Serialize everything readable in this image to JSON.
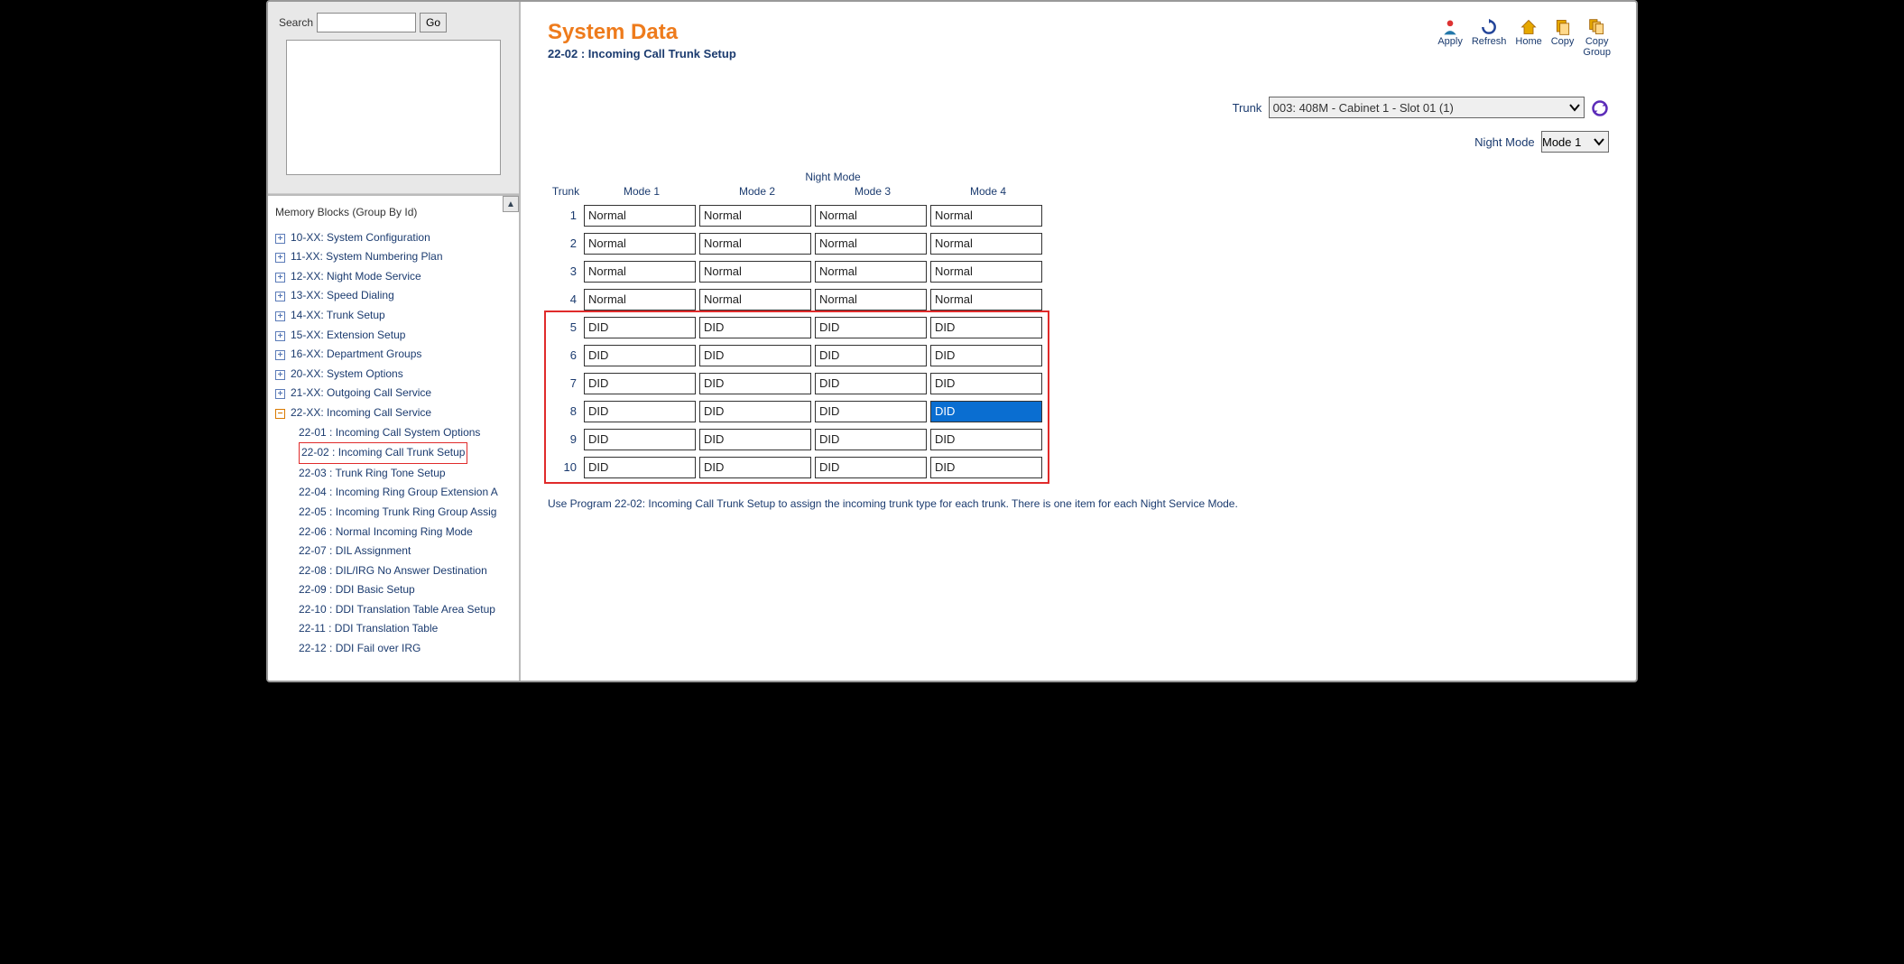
{
  "search": {
    "label": "Search",
    "go": "Go",
    "value": ""
  },
  "tree": {
    "heading": "Memory Blocks (Group By Id)",
    "items": [
      {
        "label": "10-XX: System Configuration",
        "expanded": false
      },
      {
        "label": "11-XX: System Numbering Plan",
        "expanded": false
      },
      {
        "label": "12-XX: Night Mode Service",
        "expanded": false
      },
      {
        "label": "13-XX: Speed Dialing",
        "expanded": false
      },
      {
        "label": "14-XX: Trunk Setup",
        "expanded": false
      },
      {
        "label": "15-XX: Extension Setup",
        "expanded": false
      },
      {
        "label": "16-XX: Department Groups",
        "expanded": false
      },
      {
        "label": "20-XX: System Options",
        "expanded": false
      },
      {
        "label": "21-XX: Outgoing Call Service",
        "expanded": false
      },
      {
        "label": "22-XX: Incoming Call Service",
        "expanded": true,
        "children": [
          {
            "label": "22-01 : Incoming Call System Options",
            "highlighted": false
          },
          {
            "label": "22-02 : Incoming Call Trunk Setup",
            "highlighted": true
          },
          {
            "label": "22-03 : Trunk Ring Tone Setup",
            "highlighted": false
          },
          {
            "label": "22-04 : Incoming Ring Group Extension A",
            "highlighted": false
          },
          {
            "label": "22-05 : Incoming Trunk Ring Group Assig",
            "highlighted": false
          },
          {
            "label": "22-06 : Normal Incoming Ring Mode",
            "highlighted": false
          },
          {
            "label": "22-07 : DIL Assignment",
            "highlighted": false
          },
          {
            "label": "22-08 : DIL/IRG No Answer Destination",
            "highlighted": false
          },
          {
            "label": "22-09 : DDI Basic Setup",
            "highlighted": false
          },
          {
            "label": "22-10 : DDI Translation Table Area Setup",
            "highlighted": false
          },
          {
            "label": "22-11 : DDI Translation Table",
            "highlighted": false
          },
          {
            "label": "22-12 : DDI Fail over IRG",
            "highlighted": false
          }
        ]
      }
    ]
  },
  "main": {
    "title": "System Data",
    "subtitle": "22-02 : Incoming Call Trunk Setup",
    "hint": "Use Program 22-02: Incoming Call Trunk Setup to assign the incoming trunk type for each trunk. There is one item for each Night Service Mode."
  },
  "toolbar": {
    "apply": "Apply",
    "refresh": "Refresh",
    "home": "Home",
    "copy": "Copy",
    "copy_group": "Copy\nGroup"
  },
  "selectors": {
    "trunk_label": "Trunk",
    "trunk_value": "003: 408M - Cabinet 1 - Slot 01 (1)",
    "night_mode_label": "Night Mode",
    "night_mode_value": "Mode 1"
  },
  "grid": {
    "col_group": "Night Mode",
    "col_trunk": "Trunk",
    "cols": [
      "Mode 1",
      "Mode 2",
      "Mode 3",
      "Mode 4"
    ],
    "rows": [
      {
        "n": "1",
        "v": [
          "Normal",
          "Normal",
          "Normal",
          "Normal"
        ],
        "hl": false
      },
      {
        "n": "2",
        "v": [
          "Normal",
          "Normal",
          "Normal",
          "Normal"
        ],
        "hl": false
      },
      {
        "n": "3",
        "v": [
          "Normal",
          "Normal",
          "Normal",
          "Normal"
        ],
        "hl": false
      },
      {
        "n": "4",
        "v": [
          "Normal",
          "Normal",
          "Normal",
          "Normal"
        ],
        "hl": false
      },
      {
        "n": "5",
        "v": [
          "DID",
          "DID",
          "DID",
          "DID"
        ],
        "hl": true
      },
      {
        "n": "6",
        "v": [
          "DID",
          "DID",
          "DID",
          "DID"
        ],
        "hl": true
      },
      {
        "n": "7",
        "v": [
          "DID",
          "DID",
          "DID",
          "DID"
        ],
        "hl": true
      },
      {
        "n": "8",
        "v": [
          "DID",
          "DID",
          "DID",
          "DID"
        ],
        "hl": true,
        "cell_hl": 3
      },
      {
        "n": "9",
        "v": [
          "DID",
          "DID",
          "DID",
          "DID"
        ],
        "hl": true
      },
      {
        "n": "10",
        "v": [
          "DID",
          "DID",
          "DID",
          "DID"
        ],
        "hl": true
      }
    ]
  }
}
